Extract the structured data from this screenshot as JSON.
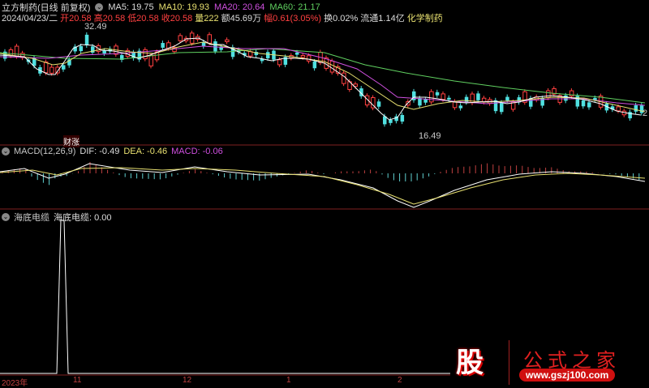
{
  "header": {
    "stock": "立方制药(日线 前复权)",
    "ma5": "MA5: 19.75",
    "ma10": "MA10: 19.93",
    "ma20": "MA20: 20.64",
    "ma60": "MA60: 21.17",
    "date": "2024/04/23/二",
    "open": "开20.58",
    "high": "高20.58",
    "low": "低20.58",
    "close": "收20.58",
    "volume": "量222",
    "amount": "额45.69万",
    "change": "幅0.61(3.05%)",
    "turnover": "换0.02%",
    "float": "流通1.14亿",
    "industry": "化学制药"
  },
  "price_labels": {
    "high": "32.49",
    "low": "16.49",
    "right": "2"
  },
  "event_tag": "财涨",
  "macd": {
    "title": "MACD(12,26,9)",
    "dif": "DIF: -0.49",
    "dea": "DEA: -0.46",
    "macd": "MACD: -0.06"
  },
  "indicator": {
    "title": "海底电缆",
    "value": "海底电缆: 0.00"
  },
  "xaxis": [
    "2023年",
    "11",
    "12",
    "1",
    "2"
  ],
  "logo": {
    "char": "股",
    "text": "公式之家",
    "url": "www.gszj100.com"
  },
  "colors": {
    "up": "#ff4040",
    "down": "#50e0e0",
    "ma5": "#ffffff",
    "ma10": "#e8e070",
    "ma20": "#d050e0",
    "ma60": "#60d060"
  }
}
